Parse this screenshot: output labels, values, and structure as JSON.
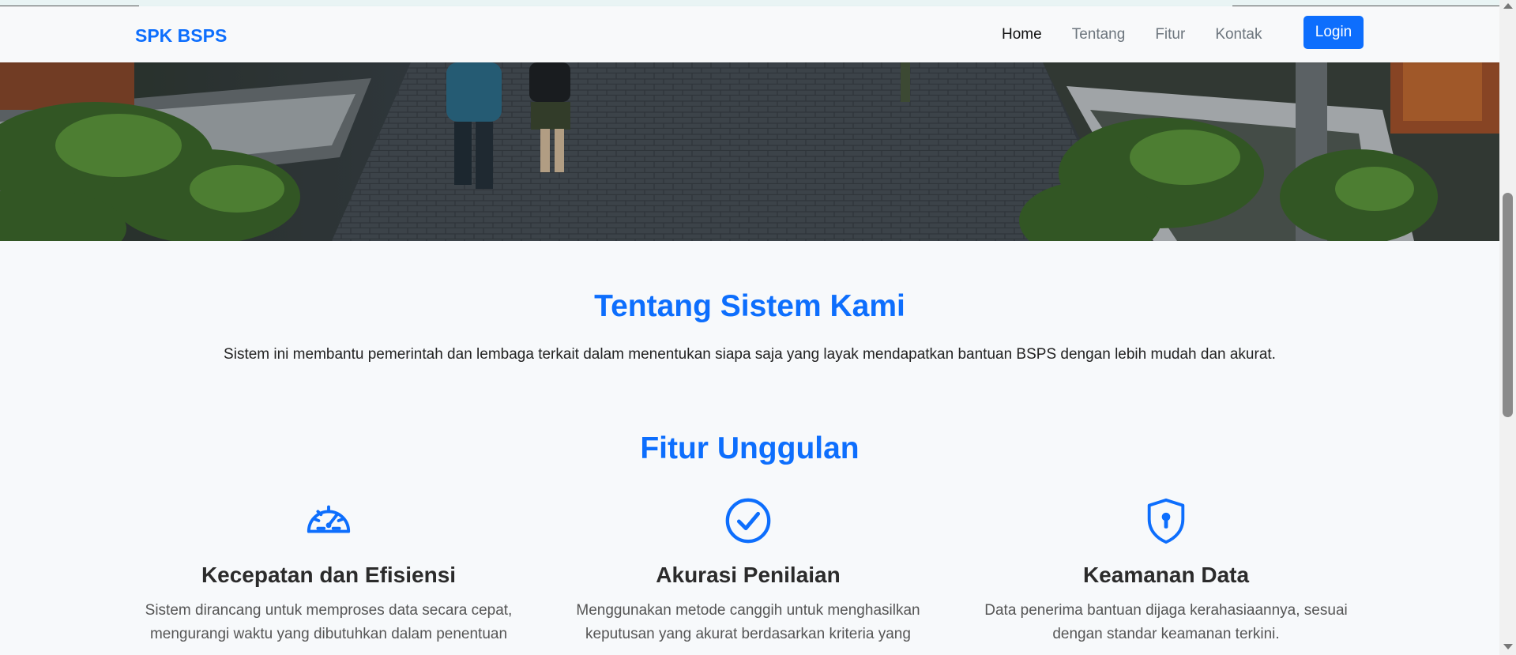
{
  "navbar": {
    "brand": "SPK BSPS",
    "links": [
      {
        "label": "Home",
        "active": true
      },
      {
        "label": "Tentang",
        "active": false
      },
      {
        "label": "Fitur",
        "active": false
      },
      {
        "label": "Kontak",
        "active": false
      }
    ],
    "login_label": "Login"
  },
  "hero": {
    "image": "housing-courtyard-photo"
  },
  "about": {
    "title": "Tentang Sistem Kami",
    "text": "Sistem ini membantu pemerintah dan lembaga terkait dalam menentukan siapa saja yang layak mendapatkan bantuan BSPS dengan lebih mudah dan akurat."
  },
  "features": {
    "title": "Fitur Unggulan",
    "items": [
      {
        "icon": "speedometer-icon",
        "title": "Kecepatan dan Efisiensi",
        "text": "Sistem dirancang untuk memproses data secara cepat, mengurangi waktu yang dibutuhkan dalam penentuan"
      },
      {
        "icon": "check-circle-icon",
        "title": "Akurasi Penilaian",
        "text": "Menggunakan metode canggih untuk menghasilkan keputusan yang akurat berdasarkan kriteria yang"
      },
      {
        "icon": "shield-lock-icon",
        "title": "Keamanan Data",
        "text": "Data penerima bantuan dijaga kerahasiaannya, sesuai dengan standar keamanan terkini."
      }
    ]
  },
  "colors": {
    "primary": "#0d6efd",
    "background": "#f7f9fb",
    "navbar": "#f8f9fa"
  }
}
